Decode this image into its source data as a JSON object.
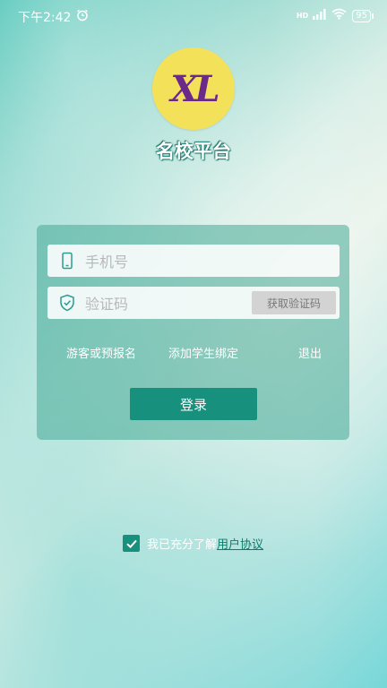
{
  "status_bar": {
    "time": "下午2:42",
    "network": "HD",
    "battery": "95"
  },
  "app": {
    "logo_text": "XL",
    "name": "名校平台"
  },
  "login_form": {
    "phone_placeholder": "手机号",
    "code_placeholder": "验证码",
    "get_code_label": "获取验证码",
    "guest_label": "游客或预报名",
    "bind_student_label": "添加学生绑定",
    "exit_label": "退出",
    "login_label": "登录"
  },
  "agreement": {
    "text": "我已充分了解",
    "link": "用户协议",
    "checked": true
  },
  "colors": {
    "accent": "#17907d",
    "logo_bg": "#f4e15a",
    "logo_text": "#6b2a8a"
  }
}
